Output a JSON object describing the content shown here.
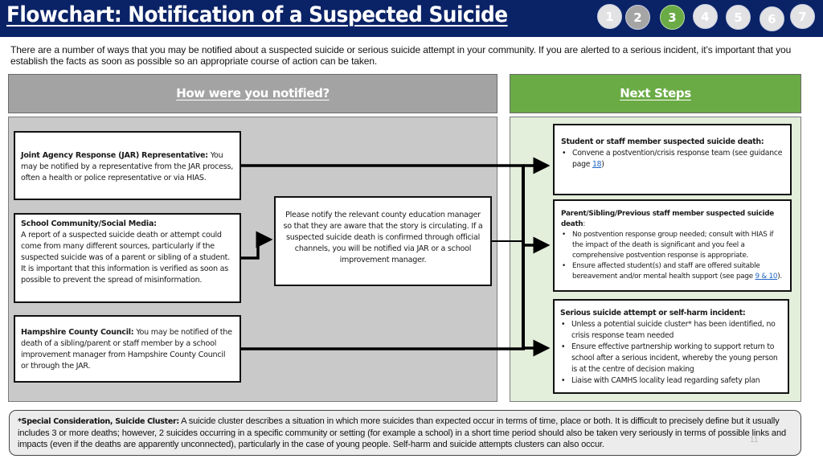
{
  "header": {
    "title": "Flowchart: Notification of a Suspected Suicide",
    "steps": [
      {
        "label": "1",
        "state": "default"
      },
      {
        "label": "2",
        "state": "visited"
      },
      {
        "label": "3",
        "state": "active"
      },
      {
        "label": "4",
        "state": "default"
      },
      {
        "label": "5",
        "state": "default"
      },
      {
        "label": "6",
        "state": "default"
      },
      {
        "label": "7",
        "state": "default"
      }
    ]
  },
  "intro": "There are a number of ways that you may be notified about a suspected suicide or serious suicide attempt in your community. If you are alerted to a serious incident, it’s important that you establish the facts as soon as possible so an appropriate course of action can be taken.",
  "left_panel": {
    "heading": "How were you notified?",
    "sources": [
      {
        "title": "Joint Agency Response (JAR) Representative:",
        "text": " You may be notified by a representative from the JAR process, often a health or police representative or via HIAS."
      },
      {
        "title": "School Community/Social Media:",
        "text": "A report of a suspected suicide death or attempt could come from many  different sources, particularly if the suspected suicide was of a parent or sibling of a student. It is important that this information is verified as soon as possible to prevent the spread of misinformation."
      },
      {
        "title": "Hampshire County Council:",
        "text": " You may be notified of the death of a sibling/parent or staff member by a school improvement manager from Hampshire County Council or through the JAR."
      }
    ],
    "notify_box": "Please notify the relevant county education manager so that they are aware that the story is circulating. If a suspected suicide death is confirmed through official channels, you will be notified via JAR or a school improvement manager."
  },
  "right_panel": {
    "heading": "Next Steps",
    "steps": [
      {
        "title": "Student or staff member suspected suicide death:",
        "bullets": [
          {
            "text": "Convene a postvention/crisis response team (see guidance page ",
            "link": "18",
            "after": ")"
          }
        ]
      },
      {
        "title": "Parent/Sibling/Previous staff member suspected suicide death",
        "title_suffix": ":",
        "bullets": [
          {
            "text": "No postvention response group needed; consult with HIAS if the impact of the death is significant and you feel a comprehensive postvention response is appropriate."
          },
          {
            "text": "Ensure affected student(s) and staff are offered suitable bereavement and/or mental health support (see page ",
            "link": "9 & 10",
            "after": ")."
          }
        ]
      },
      {
        "title": "Serious suicide attempt or self-harm incident:",
        "bullets": [
          {
            "text": "Unless a potential suicide cluster* has been identified, no crisis response team needed"
          },
          {
            "text": "Ensure effective partnership working to support return to school after a serious incident, whereby the young person is at the centre of decision making"
          },
          {
            "text": "Liaise with CAMHS locality lead regarding safety plan"
          }
        ]
      }
    ]
  },
  "footnote": {
    "title": "*Special Consideration, Suicide Cluster:",
    "text": " A suicide cluster describes a situation in which more suicides than expected occur in terms of time, place or both. It is difficult to precisely define but it usually includes 3 or more deaths; however, 2 suicides occurring in a specific community or setting (for example a school) in a short time period should also be taken very seriously in terms of possible links and impacts (even if the deaths are apparently unconnected), particularly in the case of young people. Self-harm and suicide attempts clusters can also occur."
  },
  "page_number": "11",
  "colors": {
    "header_bg": "#0a2266",
    "active_step": "#6aab45",
    "visited_step": "#a5a5a5",
    "left_heading_bg": "#a3a3a3",
    "right_heading_bg": "#6aab45",
    "left_panel_bg": "#c9c9c9",
    "right_panel_bg": "#e3eedb",
    "link": "#1f63c4"
  }
}
